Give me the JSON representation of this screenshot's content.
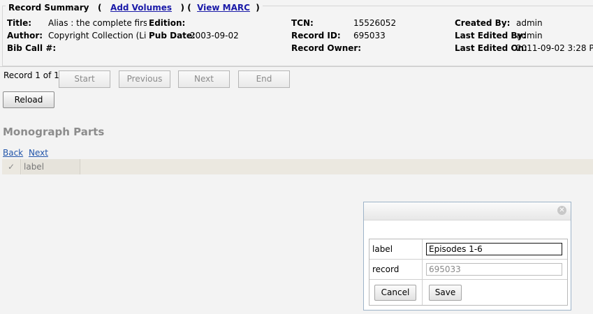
{
  "summary": {
    "legend_title": "Record Summary",
    "open_paren": "(",
    "add_volumes_link": "Add Volumes",
    "sep": ") (",
    "view_marc_link": "View MARC",
    "close_paren": ")",
    "title_label": "Title:",
    "title_value": "Alias : the complete first se",
    "author_label": "Author:",
    "author_value": "Copyright Collection (Libr",
    "bibcall_label": "Bib Call #:",
    "edition_label": "Edition:",
    "pubdate_label": "Pub Date:",
    "pubdate_value": "2003-09-02",
    "tcn_label": "TCN:",
    "tcn_value": "15526052",
    "record_id_label": "Record ID:",
    "record_id_value": "695033",
    "record_owner_label": "Record Owner:",
    "created_by_label": "Created By:",
    "created_by_value": "admin",
    "last_edited_by_label": "Last Edited By:",
    "last_edited_by_value": "admin",
    "last_edited_on_label": "Last Edited On:",
    "last_edited_on_value": "2011-09-02 3:28 PM"
  },
  "nav": {
    "record_count": "Record 1 of 1",
    "start": "Start",
    "previous": "Previous",
    "next": "Next",
    "end": "End",
    "reload": "Reload"
  },
  "monograph": {
    "title": "Monograph Parts",
    "back_link": "Back",
    "next_link": "Next",
    "check_header": "✓",
    "label_header": "label"
  },
  "dialog": {
    "close_icon": "✕",
    "label_field_label": "label",
    "label_field_value": "Episodes 1-6",
    "record_field_label": "record",
    "record_field_value": "695033",
    "cancel": "Cancel",
    "save": "Save"
  },
  "colors": {
    "link": "#1a1aa8",
    "grid_header_bg": "#ebe8e0",
    "dialog_border": "#9db3c8"
  }
}
